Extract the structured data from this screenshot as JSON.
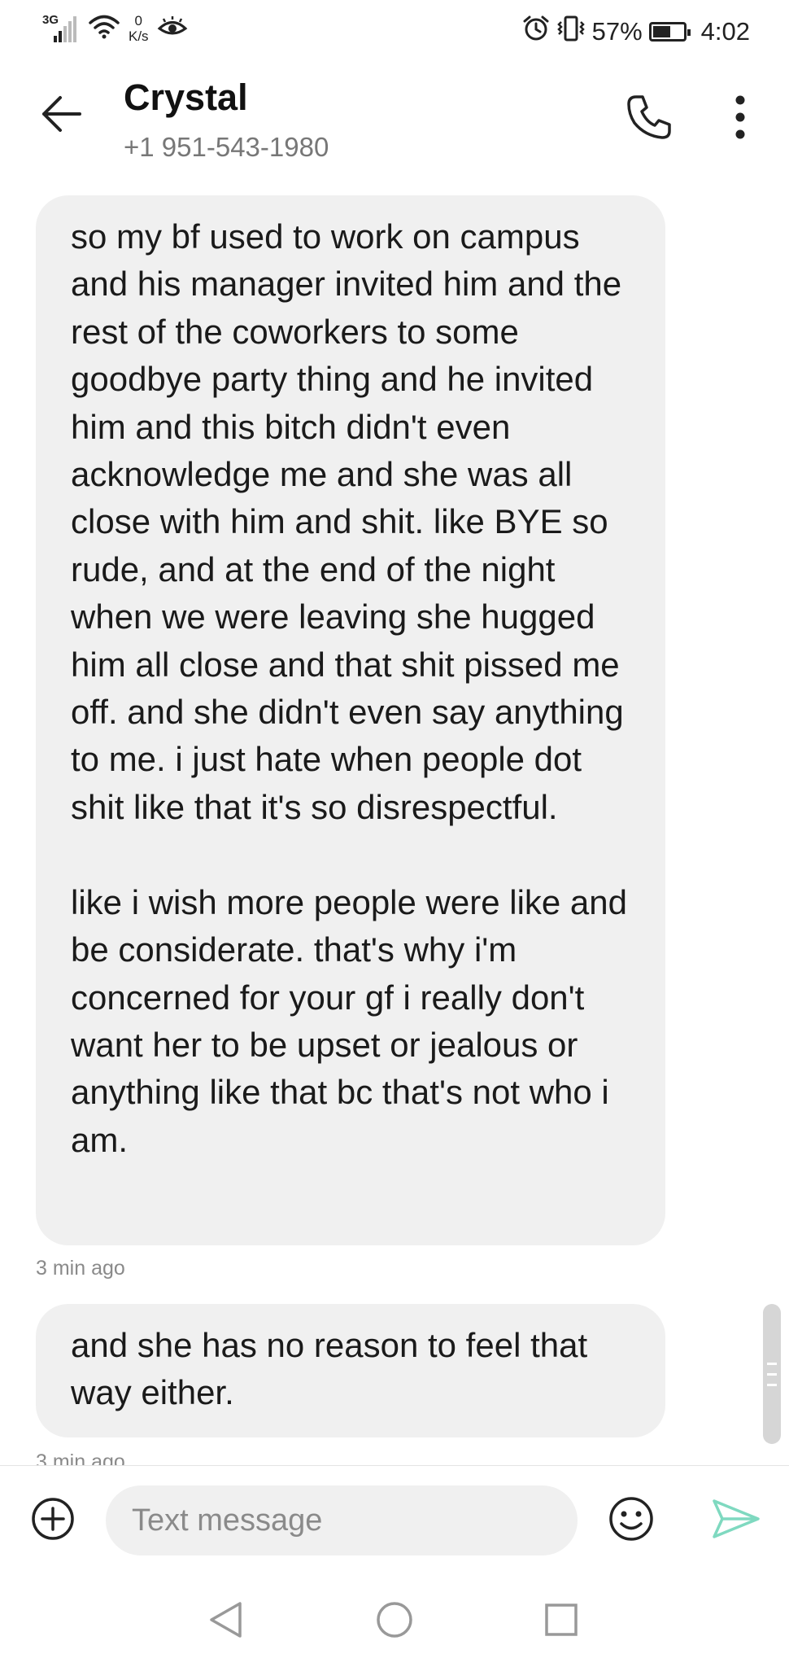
{
  "status_bar": {
    "network": "3G",
    "speed_value": "0",
    "speed_unit": "K/s",
    "battery_percent": "57%",
    "battery_level": 0.57,
    "time": "4:02"
  },
  "header": {
    "contact_name": "Crystal",
    "contact_number": "+1 951-543-1980"
  },
  "messages": [
    {
      "text": "so my bf used to work on campus and his manager invited him and the rest of the coworkers to some goodbye party thing and he invited him and this bitch didn't even acknowledge me and she was all close with him and shit. like BYE so rude, and at the end of the night when we were leaving she hugged him all close and that shit pissed me off. and she didn't even say anything to me. i just hate when people dot shit like that it's so disrespectful.\n\nlike i wish more people were like and be considerate. that's why i'm concerned for your gf i really don't want her to be upset or jealous or anything like that bc that's not who i am.",
      "time": "3 min ago"
    },
    {
      "text": "and she has no reason to feel that way either.",
      "time": "3 min ago"
    }
  ],
  "composer": {
    "placeholder": "Text message"
  },
  "icons": {
    "back": "arrow-left-icon",
    "call": "phone-icon",
    "more": "more-vertical-icon",
    "add": "plus-circle-icon",
    "emoji": "smiley-icon",
    "send": "send-icon",
    "alarm": "alarm-icon",
    "vibrate": "vibrate-icon",
    "wifi": "wifi-icon",
    "signal": "signal-icon",
    "eye": "eye-icon"
  },
  "colors": {
    "bubble": "#f0f0f0",
    "send_accent": "#7fd9c0",
    "timestamp": "#8a8a8a"
  }
}
